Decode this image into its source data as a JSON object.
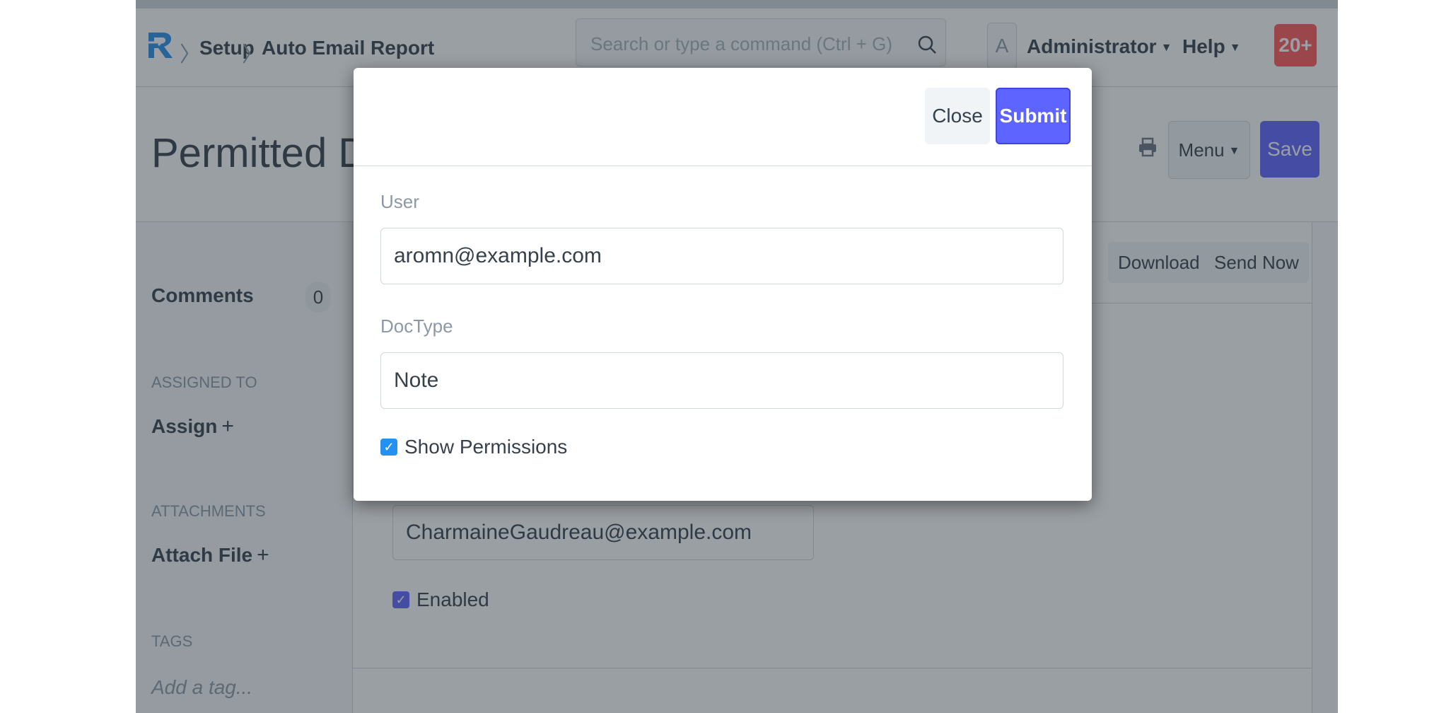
{
  "navbar": {
    "breadcrumbs": [
      "Setup",
      "Auto Email Report"
    ],
    "search_placeholder": "Search or type a command (Ctrl + G)",
    "avatar_letter": "A",
    "user_label": "Administrator",
    "help_label": "Help",
    "notification_count": "20+"
  },
  "page": {
    "title": "Permitted Documents For User",
    "menu_label": "Menu",
    "save_label": "Save"
  },
  "sidebar": {
    "comments_label": "Comments",
    "comments_count": "0",
    "assigned_heading": "ASSIGNED TO",
    "assign_label": "Assign",
    "attachments_heading": "ATTACHMENTS",
    "attach_label": "Attach File",
    "tags_heading": "TAGS",
    "tag_placeholder": "Add a tag..."
  },
  "form": {
    "download_label": "Download",
    "send_now_label": "Send Now",
    "email_value": "CharmaineGaudreau@example.com",
    "enabled_label": "Enabled"
  },
  "modal": {
    "close_label": "Close",
    "submit_label": "Submit",
    "user_label": "User",
    "user_value": "aromn@example.com",
    "doctype_label": "DocType",
    "doctype_value": "Note",
    "show_permissions_label": "Show Permissions"
  },
  "colors": {
    "primary": "#5e64ff",
    "danger": "#ff5858",
    "checkbox": "#2490ef",
    "text": "#36414c",
    "muted": "#8d99a6"
  },
  "icons": [
    "logo",
    "search-icon",
    "print-icon",
    "chevron-down-icon",
    "plus-icon",
    "check-icon"
  ]
}
